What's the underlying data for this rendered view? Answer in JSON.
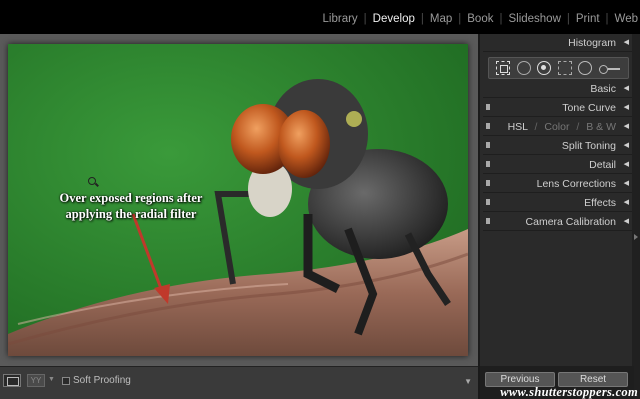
{
  "modules": [
    {
      "label": "Library",
      "active": false
    },
    {
      "label": "Develop",
      "active": true
    },
    {
      "label": "Map",
      "active": false
    },
    {
      "label": "Book",
      "active": false
    },
    {
      "label": "Slideshow",
      "active": false
    },
    {
      "label": "Print",
      "active": false
    },
    {
      "label": "Web",
      "active": false
    }
  ],
  "separator": "|",
  "photo": {
    "annotation": "Over exposed regions after applying the radial filter",
    "background_color": "#2e7d2e",
    "arrow_color": "#c0392b"
  },
  "toolbar": {
    "view_mode_icon": "loupe-view-icon",
    "compare_icon": "before-after-icon",
    "compare_label": "YY",
    "soft_proofing_label": "Soft Proofing",
    "soft_proofing_checked": false
  },
  "right_panel": {
    "histogram": "Histogram",
    "tools": [
      "crop-overlay-icon",
      "spot-removal-icon",
      "red-eye-icon",
      "graduated-filter-icon",
      "radial-filter-icon",
      "adjustment-brush-icon"
    ],
    "panels": {
      "basic": "Basic",
      "tone_curve": "Tone Curve",
      "hsl": "HSL",
      "color": "Color",
      "bw": "B & W",
      "split_toning": "Split Toning",
      "detail": "Detail",
      "lens_corrections": "Lens Corrections",
      "effects": "Effects",
      "camera_calibration": "Camera Calibration"
    },
    "hsl_sep": "/",
    "previous_button": "Previous",
    "reset_button": "Reset"
  },
  "watermark": "www.shutterstoppers.com"
}
